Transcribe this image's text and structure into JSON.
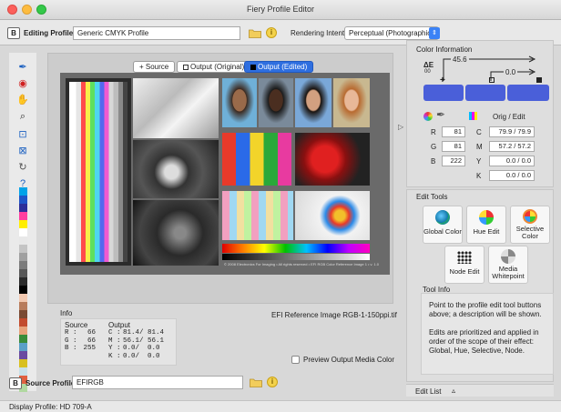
{
  "window": {
    "title": "Fiery Profile Editor"
  },
  "toolbar": {
    "editing_profile_label": "Editing Profile:",
    "editing_profile_value": "Generic CMYK Profile",
    "rendering_intent_label": "Rendering Intent:",
    "rendering_intent_value": "Perceptual (Photographic)"
  },
  "view_tabs": [
    "+ Source",
    "Output (Original)",
    "Output (Edited)"
  ],
  "image": {
    "caption": "EFI Reference Image RGB-1-150ppi.tif",
    "footer_text": "© 2008 Electronics For Imaging  •  All rights reserved  •  EFI RGB Color Reference Image 1 • v. 1.0.1"
  },
  "info": {
    "title": "Info",
    "source_header": "Source",
    "output_header": "Output",
    "source": [
      [
        "R :",
        "66"
      ],
      [
        "G :",
        "66"
      ],
      [
        "B :",
        "255"
      ]
    ],
    "output": [
      [
        "C :",
        "81.4/ 81.4"
      ],
      [
        "M :",
        "56.1/ 56.1"
      ],
      [
        "Y :",
        "0.0/  0.0"
      ],
      [
        "K :",
        "0.0/  0.0"
      ]
    ],
    "preview_label": "Preview Output Media Color"
  },
  "source_profile": {
    "label": "Source Profile:",
    "value": "EFIRGB"
  },
  "status": {
    "display_profile": "Display Profile:  HD 709-A"
  },
  "color_info": {
    "title": "Color Information",
    "delta_e_label": "ΔE",
    "delta_e_sub": "00",
    "delta_1": "45.6",
    "delta_2": "0.0",
    "orig_edit_label": "Orig / Edit",
    "rgb": [
      [
        "R",
        "81"
      ],
      [
        "G",
        "81"
      ],
      [
        "B",
        "222"
      ]
    ],
    "cmyk": [
      [
        "C",
        "79.9 /  79.9"
      ],
      [
        "M",
        "57.2 /  57.2"
      ],
      [
        "Y",
        "0.0 /   0.0"
      ],
      [
        "K",
        "0.0 /   0.0"
      ]
    ],
    "swatch_color": "#4a5fd9"
  },
  "edit_tools": {
    "title": "Edit Tools",
    "buttons": [
      {
        "label": "Global Color",
        "icon": "globe-icon"
      },
      {
        "label": "Hue Edit",
        "icon": "color-wheel-icon"
      },
      {
        "label": "Selective Color",
        "icon": "crosshair-color-icon"
      },
      {
        "label": "Node Edit",
        "icon": "node-grid-icon"
      },
      {
        "label": "Media Whitepoint",
        "icon": "whitepoint-icon"
      }
    ]
  },
  "tool_info": {
    "title": "Tool Info",
    "para1": "Point to the profile edit tool buttons above; a description will be shown.",
    "para2": "Edits are prioritized and applied in order of the scope of their effect: Global, Hue, Selective, Node."
  },
  "edit_list": {
    "label": "Edit List"
  },
  "palette": [
    "#00a2e8",
    "#1e55c8",
    "#2c2e9a",
    "#ff3fa0",
    "#ffee00",
    "#ffffff",
    "#e8e8e8",
    "#c4c4c4",
    "#a0a0a0",
    "#7c7c7c",
    "#585858",
    "#2a2a2a",
    "#000000",
    "#f2c8b0",
    "#b87c5c",
    "#7a4a33",
    "#c24b2e",
    "#e7a27a",
    "#3a8c3a",
    "#5aa0c8",
    "#6a4aa0",
    "#d8c020",
    "#c8e0e8",
    "#e06040",
    "#b0d8a0"
  ]
}
